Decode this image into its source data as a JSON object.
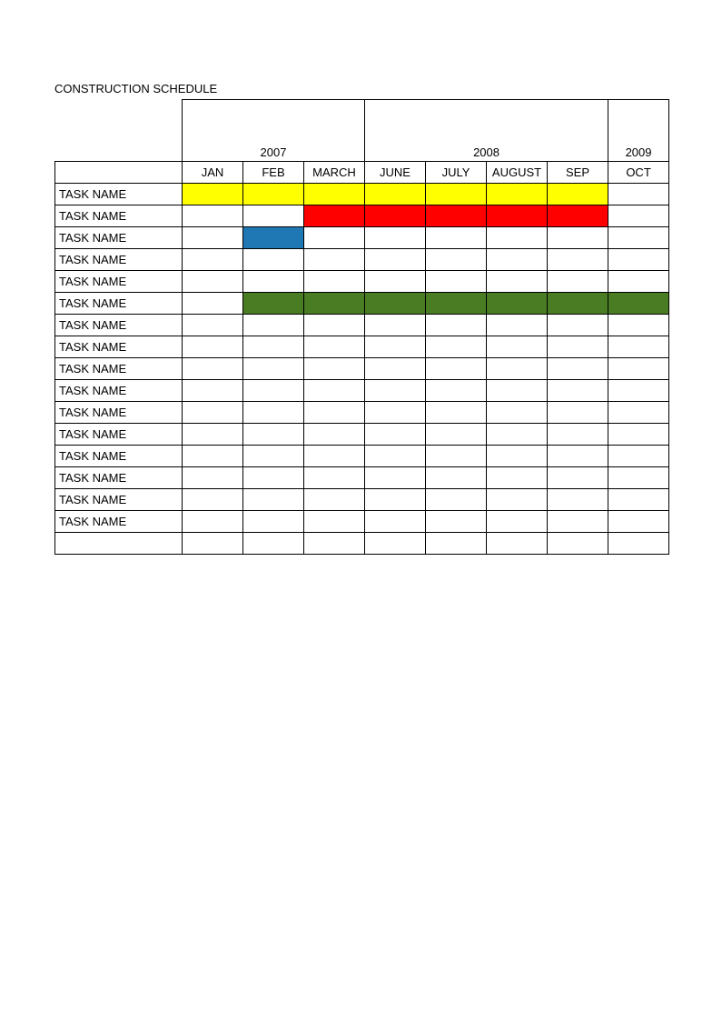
{
  "title": "CONSTRUCTION SCHEDULE",
  "chart_data": {
    "type": "table",
    "title": "CONSTRUCTION SCHEDULE",
    "year_groups": [
      {
        "year": "2007",
        "months": [
          "JAN",
          "FEB",
          "MARCH"
        ]
      },
      {
        "year": "2008",
        "months": [
          "JUNE",
          "JULY",
          "AUGUST",
          "SEP"
        ]
      },
      {
        "year": "2009",
        "months": [
          "OCT"
        ]
      }
    ],
    "months": [
      "JAN",
      "FEB",
      "MARCH",
      "JUNE",
      "JULY",
      "AUGUST",
      "SEP",
      "OCT"
    ],
    "tasks": [
      {
        "name": "TASK NAME",
        "bars": [
          {
            "start": 0,
            "end": 6,
            "color": "#FFFF00"
          }
        ]
      },
      {
        "name": "TASK NAME",
        "bars": [
          {
            "start": 2,
            "end": 6,
            "color": "#FF0000"
          }
        ]
      },
      {
        "name": "TASK NAME",
        "bars": [
          {
            "start": 1,
            "end": 1,
            "color": "#1F77B4"
          }
        ]
      },
      {
        "name": "TASK NAME",
        "bars": []
      },
      {
        "name": "TASK NAME",
        "bars": []
      },
      {
        "name": "TASK NAME",
        "bars": [
          {
            "start": 1,
            "end": 7,
            "color": "#4A7D23"
          }
        ]
      },
      {
        "name": "TASK NAME",
        "bars": []
      },
      {
        "name": "TASK NAME",
        "bars": []
      },
      {
        "name": "TASK NAME",
        "bars": []
      },
      {
        "name": "TASK NAME",
        "bars": []
      },
      {
        "name": "TASK NAME",
        "bars": []
      },
      {
        "name": "TASK NAME",
        "bars": []
      },
      {
        "name": "TASK NAME",
        "bars": []
      },
      {
        "name": "TASK NAME",
        "bars": []
      },
      {
        "name": "TASK NAME",
        "bars": []
      },
      {
        "name": "TASK NAME",
        "bars": []
      },
      {
        "name": "",
        "bars": []
      }
    ],
    "colors": {
      "yellow": "#FFFF00",
      "red": "#FF0000",
      "blue": "#1F77B4",
      "green": "#4A7D23"
    }
  }
}
